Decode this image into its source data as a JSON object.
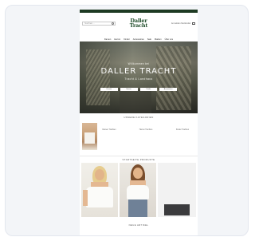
{
  "header": {
    "search_placeholder": "Suchen...",
    "logo_line1": "Daller",
    "logo_line2": "Tracht",
    "links": "Anmelden  Merkzettel"
  },
  "nav": {
    "items": [
      "Damen",
      "Herren",
      "Kinder",
      "Accessoires",
      "Sale",
      "Marken",
      "Über uns"
    ]
  },
  "hero": {
    "kicker": "Willkommen bei",
    "title": "DALLER TRACHT",
    "subtitle": "Tracht & Landhaus",
    "buttons": [
      "Damen",
      "Herren",
      "Kinder",
      "Accessoires"
    ]
  },
  "categories": {
    "title": "UNSERE KATEGORIEN",
    "items": [
      {
        "label": "Damen Trachten"
      },
      {
        "label": "Herren Trachten"
      },
      {
        "label": "Kinder Trachten"
      }
    ]
  },
  "products": {
    "title": "STARTSEITE PRODUKTE"
  },
  "section2": {
    "title": "NEUE ARTIKEL"
  }
}
